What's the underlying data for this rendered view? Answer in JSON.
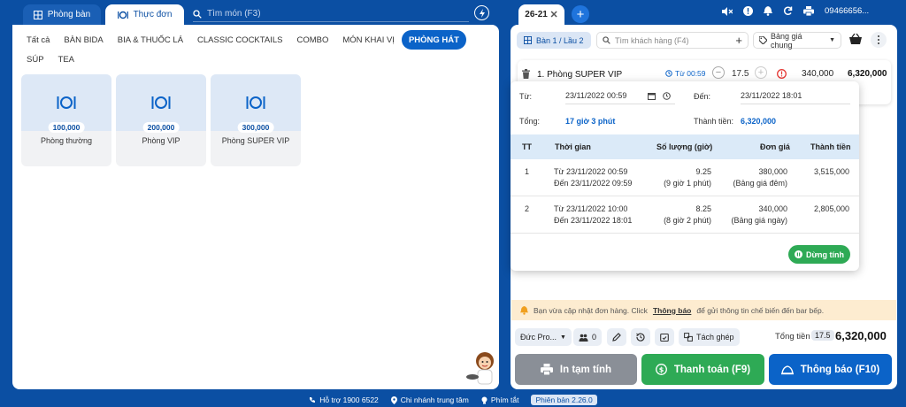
{
  "top_tabs": {
    "tables": "Phòng bàn",
    "menu": "Thực đơn"
  },
  "search_placeholder": "Tìm món (F3)",
  "categories": [
    "Tất cả",
    "BÀN BIDA",
    "BIA & THUỐC LÁ",
    "CLASSIC COCKTAILS",
    "COMBO",
    "MÓN KHAI VỊ",
    "PHÒNG HÁT",
    "SÚP",
    "TEA"
  ],
  "active_category": "PHÒNG HÁT",
  "products": [
    {
      "name": "Phòng thường",
      "price": "100,000"
    },
    {
      "name": "Phòng VIP",
      "price": "200,000"
    },
    {
      "name": "Phòng SUPER VIP",
      "price": "300,000"
    }
  ],
  "footer": {
    "hotline": "Hỗ trợ 1900 6522",
    "branch": "Chi nhánh trung tâm",
    "shortcuts": "Phím tắt",
    "version": "Phiên bản 2.26.0"
  },
  "order": {
    "tab_label": "26-21",
    "table_label": "Bàn 1 / Lầu 2",
    "customer_placeholder": "Tìm khách hàng (F4)",
    "pricelist": "Bảng giá chung",
    "phone": "09466656...",
    "line": {
      "name": "1. Phòng SUPER VIP",
      "time": "Từ 00:59",
      "qty": "17.5",
      "unit_price": "340,000",
      "amount": "6,320,000"
    }
  },
  "popover": {
    "from_label": "Từ:",
    "from_value": "23/11/2022 00:59",
    "to_label": "Đến:",
    "to_value": "23/11/2022 18:01",
    "total_label": "Tổng:",
    "total_value": "17 giờ 3 phút",
    "amount_label": "Thành tiền:",
    "amount_value": "6,320,000",
    "headers": [
      "TT",
      "Thời gian",
      "Số lượng (giờ)",
      "Đơn giá",
      "Thành tiền"
    ],
    "rows": [
      {
        "tt": "1",
        "from": "Từ 23/11/2022 00:59",
        "to": "Đến 23/11/2022 09:59",
        "qty": "9.25",
        "qty_note": "(9 giờ 1 phút)",
        "price": "380,000",
        "price_note": "(Bảng giá đêm)",
        "amount": "3,515,000"
      },
      {
        "tt": "2",
        "from": "Từ 23/11/2022 10:00",
        "to": "Đến 23/11/2022 18:01",
        "qty": "8.25",
        "qty_note": "(8 giờ 2 phút)",
        "price": "340,000",
        "price_note": "(Bảng giá ngày)",
        "amount": "2,805,000"
      }
    ],
    "stop_label": "Dừng tính"
  },
  "notice": {
    "before": "Bạn vừa cập nhật đơn hàng. Click",
    "link": "Thông báo",
    "after": "để gửi thông tin chế biến đến bar bếp."
  },
  "bottom": {
    "staff": "Đức Pro...",
    "guests": "0",
    "split": "Tách ghép",
    "total_label": "Tổng tiền",
    "total_qty": "17.5",
    "total_value": "6,320,000",
    "print_btn": "In tạm tính",
    "pay_btn": "Thanh toán (F9)",
    "notify_btn": "Thông báo (F10)"
  },
  "colors": {
    "brand": "#0b4fa3",
    "pay": "#2eaa55",
    "print": "#8a8f97",
    "notify": "#0b63c8"
  }
}
